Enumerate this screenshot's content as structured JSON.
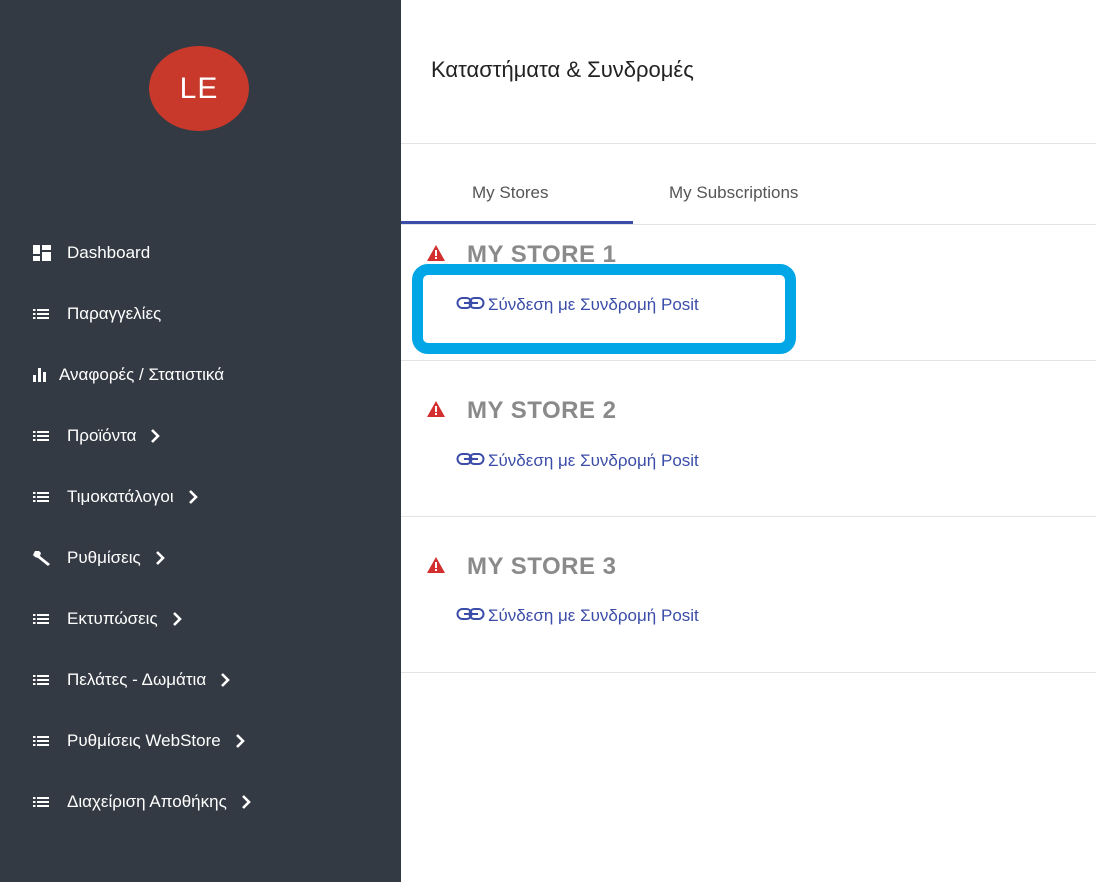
{
  "sidebar": {
    "avatar_initials": "LE",
    "items": [
      {
        "label": "Dashboard",
        "icon": "dashboard-icon",
        "has_submenu": false
      },
      {
        "label": "Παραγγελίες",
        "icon": "list-icon",
        "has_submenu": false
      },
      {
        "label": "Αναφορές / Στατιστικά",
        "icon": "bar-chart-icon",
        "has_submenu": false
      },
      {
        "label": "Προϊόντα",
        "icon": "list-icon",
        "has_submenu": true
      },
      {
        "label": "Τιμοκατάλογοι",
        "icon": "list-icon",
        "has_submenu": true
      },
      {
        "label": "Ρυθμίσεις",
        "icon": "wrench-icon",
        "has_submenu": true
      },
      {
        "label": "Εκτυπώσεις",
        "icon": "list-icon",
        "has_submenu": true
      },
      {
        "label": "Πελάτες - Δωμάτια",
        "icon": "list-icon",
        "has_submenu": true
      },
      {
        "label": "Ρυθμίσεις WebStore",
        "icon": "list-icon",
        "has_submenu": true
      },
      {
        "label": "Διαχείριση Αποθήκης",
        "icon": "list-icon",
        "has_submenu": true
      }
    ]
  },
  "main": {
    "title": "Καταστήματα & Συνδρομές",
    "tabs": [
      {
        "label": "My Stores",
        "active": true
      },
      {
        "label": "My Subscriptions",
        "active": false
      }
    ],
    "stores": [
      {
        "name": "MY STORE 1",
        "status_icon": "warning-icon",
        "link_label": "Σύνδεση με Συνδρομή Posit"
      },
      {
        "name": "MY STORE 2",
        "status_icon": "warning-icon",
        "link_label": "Σύνδεση με Συνδρομή Posit"
      },
      {
        "name": "MY STORE 3",
        "status_icon": "warning-icon",
        "link_label": "Σύνδεση με Συνδρομή Posit"
      }
    ]
  },
  "colors": {
    "sidebar_bg": "#343a43",
    "avatar_bg": "#c8392b",
    "accent": "#3b4da8",
    "warning": "#d32f2f",
    "highlight": "#00a6e6"
  }
}
